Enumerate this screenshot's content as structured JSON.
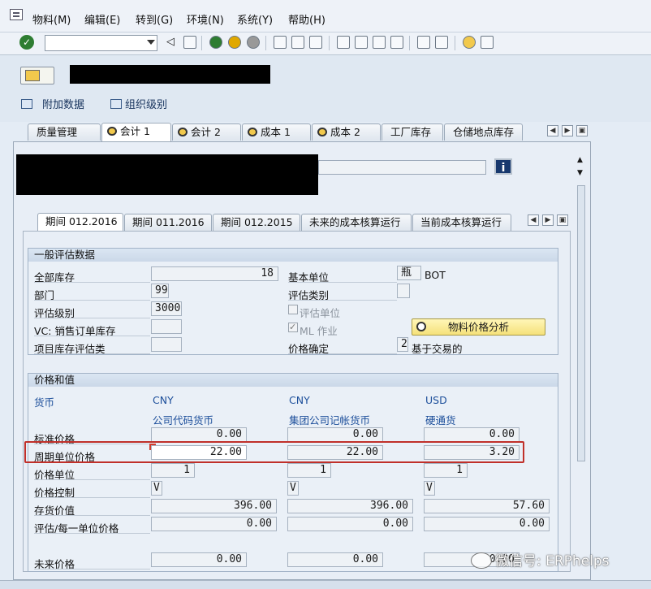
{
  "menu": [
    "物料(M)",
    "编辑(E)",
    "转到(G)",
    "环境(N)",
    "系统(Y)",
    "帮助(H)"
  ],
  "toolbar": {
    "command_value": "",
    "icons": [
      "ok-icon",
      "back-icon",
      "save-icon",
      "exit-icon",
      "cancel-icon",
      "print-icon",
      "find-icon",
      "find-next-icon",
      "first-page-icon",
      "prev-page-icon",
      "next-page-icon",
      "last-page-icon",
      "new-session-icon",
      "shortcut-icon",
      "help-icon",
      "layout-icon"
    ]
  },
  "subtoolbar": {
    "additional_data": "附加数据",
    "org_levels": "组织级别"
  },
  "tabs": [
    "质量管理",
    "会计 1",
    "会计 2",
    "成本 1",
    "成本 2",
    "工厂库存",
    "仓储地点库存"
  ],
  "active_tab": "会计 1",
  "inner_tabs": [
    "期间 012.2016",
    "期间 011.2016",
    "期间 012.2015",
    "未来的成本核算运行",
    "当前成本核算运行"
  ],
  "general": {
    "title": "一般评估数据",
    "total_stock_label": "全部库存",
    "total_stock": "18",
    "base_unit_label": "基本单位",
    "base_unit_value": "瓶",
    "base_unit_code": "BOT",
    "division_label": "部门",
    "division": "99",
    "valuation_class_label": "评估类别",
    "valuation_class": "",
    "valuation_area_label": "评估级别",
    "valuation_area": "3000",
    "valuated_unit_label": "评估单位",
    "vc_label": "VC: 销售订单库存",
    "vc_value": "",
    "ml_label": "ML 作业",
    "price_analysis_button": "物料价格分析",
    "project_stock_label": "项目库存评估类",
    "project_stock_value": "",
    "price_determination_label": "价格确定",
    "price_determination": "2",
    "price_determination_text": "基于交易的"
  },
  "prices": {
    "title": "价格和值",
    "currency_label": "货币",
    "columns": [
      {
        "currency": "CNY",
        "desc": "公司代码货币"
      },
      {
        "currency": "CNY",
        "desc": "集团公司记帐货币"
      },
      {
        "currency": "USD",
        "desc": "硬通货"
      }
    ],
    "rows": [
      {
        "label": "标准价格",
        "values": [
          "0.00",
          "0.00",
          "0.00"
        ]
      },
      {
        "label": "周期单位价格",
        "values": [
          "22.00",
          "22.00",
          "3.20"
        ]
      },
      {
        "label": "价格单位",
        "values": [
          "1",
          "1",
          "1"
        ]
      },
      {
        "label": "价格控制",
        "values": [
          "V",
          "V",
          "V"
        ]
      },
      {
        "label": "存货价值",
        "values": [
          "396.00",
          "396.00",
          "57.60"
        ]
      },
      {
        "label": "评估/每一单位价格",
        "values": [
          "0.00",
          "0.00",
          "0.00"
        ]
      },
      {
        "label": "未来价格",
        "values": [
          "0.00",
          "0.00",
          "0.00"
        ]
      }
    ]
  },
  "watermark": "微信号: ERPhelps"
}
